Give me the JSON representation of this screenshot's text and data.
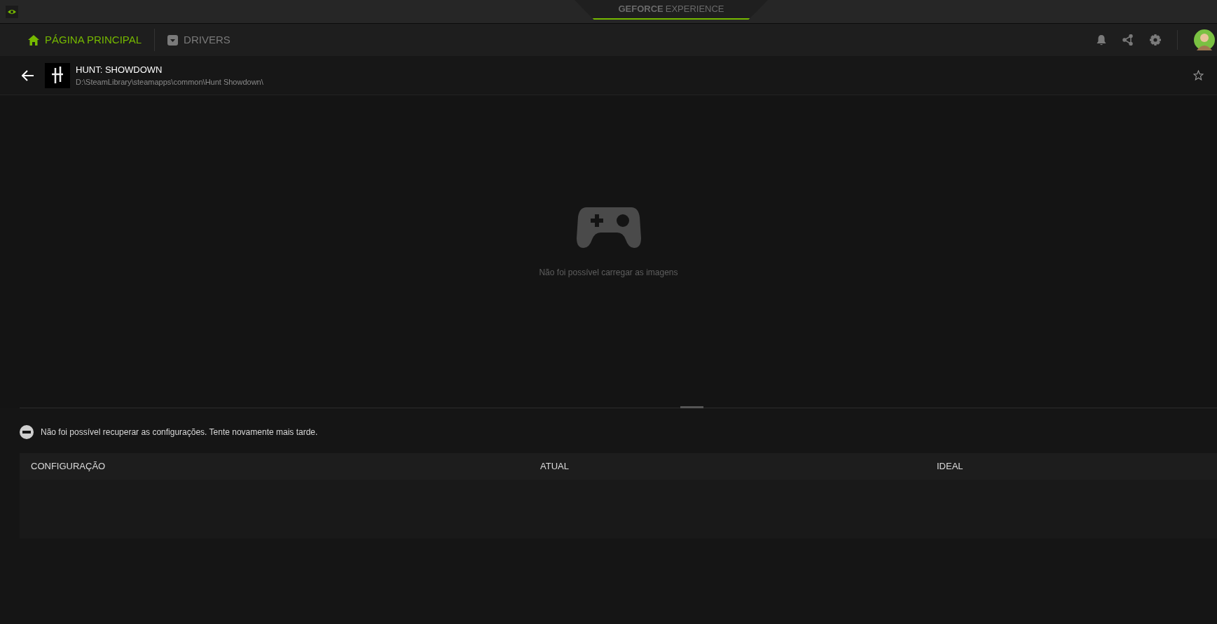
{
  "title_bar": {
    "brand": "GEFORCE",
    "brand_suffix": "EXPERIENCE"
  },
  "tabs": [
    {
      "label": "PÁGINA PRINCIPAL",
      "kind": "home",
      "selected": true
    },
    {
      "label": "DRIVERS",
      "kind": "drivers",
      "selected": false
    }
  ],
  "game": {
    "title": "HUNT: SHOWDOWN",
    "path": "D:\\SteamLibrary\\steamapps\\common\\Hunt Showdown\\",
    "favorite": false
  },
  "gallery": {
    "message": "Não foi possível carregar as imagens"
  },
  "settings": {
    "error": "Não foi possível recuperar as configurações. Tente novamente mais tarde.",
    "columns": [
      "CONFIGURAÇÃO",
      "ATUAL",
      "IDEAL"
    ]
  }
}
